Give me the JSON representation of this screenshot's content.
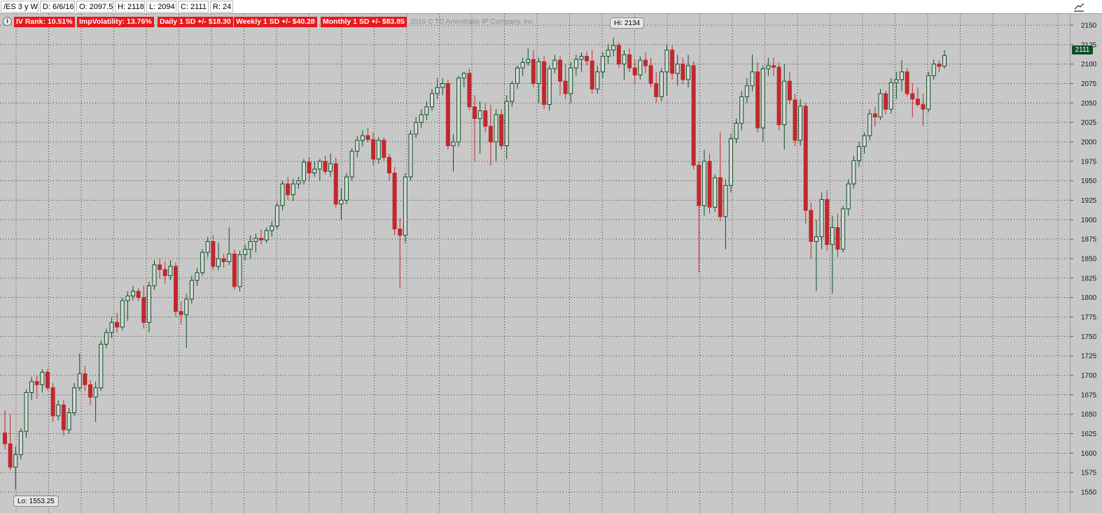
{
  "header": {
    "symbol_label": "/ES 3 y W",
    "date_label": "D: 6/6/16",
    "open_label": "O: 2097.5",
    "high_label": "H: 2118",
    "low_label": "L: 2094",
    "close_label": "C: 2111",
    "range_label": "R: 24"
  },
  "badges": {
    "iv_rank": "IV Rank: 10.51%",
    "imp_vol": "ImpVolatility: 13.76%",
    "daily_sd": "Daily 1 SD +/- $18.30",
    "weekly_sd": "Weekly 1 SD +/- $40.28",
    "monthly_sd": "Monthly 1 SD +/- $83.85"
  },
  "copyright": "2016 © TD Ameritrade IP Company, Inc.",
  "colors": {
    "up": "#0e4f26",
    "down": "#c0282d",
    "badge": "#e8181c",
    "background": "#c8c8c8"
  },
  "chart_data": {
    "type": "candlestick",
    "y_ticks": [
      1550,
      1575,
      1600,
      1625,
      1650,
      1675,
      1700,
      1725,
      1750,
      1775,
      1800,
      1825,
      1850,
      1875,
      1900,
      1925,
      1950,
      1975,
      2000,
      2025,
      2050,
      2075,
      2100,
      2125,
      2150
    ],
    "ylim": [
      1542,
      2158
    ],
    "grid": true,
    "hi_label": "Hi: 2134",
    "lo_label": "Lo: 1553.25",
    "last_price_label": "2111",
    "candles": [
      {
        "o": 1626,
        "h": 1655,
        "l": 1605,
        "c": 1612
      },
      {
        "o": 1612,
        "h": 1650,
        "l": 1578,
        "c": 1582
      },
      {
        "o": 1582,
        "h": 1608,
        "l": 1553.25,
        "c": 1598
      },
      {
        "o": 1598,
        "h": 1632,
        "l": 1592,
        "c": 1628
      },
      {
        "o": 1628,
        "h": 1682,
        "l": 1620,
        "c": 1678
      },
      {
        "o": 1678,
        "h": 1698,
        "l": 1668,
        "c": 1692
      },
      {
        "o": 1692,
        "h": 1700,
        "l": 1670,
        "c": 1688
      },
      {
        "o": 1688,
        "h": 1708,
        "l": 1678,
        "c": 1704
      },
      {
        "o": 1704,
        "h": 1708,
        "l": 1680,
        "c": 1684
      },
      {
        "o": 1684,
        "h": 1690,
        "l": 1640,
        "c": 1648
      },
      {
        "o": 1648,
        "h": 1668,
        "l": 1642,
        "c": 1662
      },
      {
        "o": 1662,
        "h": 1668,
        "l": 1622,
        "c": 1630
      },
      {
        "o": 1630,
        "h": 1658,
        "l": 1625,
        "c": 1652
      },
      {
        "o": 1652,
        "h": 1690,
        "l": 1648,
        "c": 1684
      },
      {
        "o": 1684,
        "h": 1728,
        "l": 1680,
        "c": 1702
      },
      {
        "o": 1702,
        "h": 1712,
        "l": 1680,
        "c": 1688
      },
      {
        "o": 1688,
        "h": 1694,
        "l": 1662,
        "c": 1672
      },
      {
        "o": 1672,
        "h": 1692,
        "l": 1640,
        "c": 1684
      },
      {
        "o": 1684,
        "h": 1745,
        "l": 1680,
        "c": 1740
      },
      {
        "o": 1740,
        "h": 1760,
        "l": 1735,
        "c": 1755
      },
      {
        "o": 1755,
        "h": 1775,
        "l": 1748,
        "c": 1768
      },
      {
        "o": 1768,
        "h": 1780,
        "l": 1755,
        "c": 1762
      },
      {
        "o": 1762,
        "h": 1800,
        "l": 1758,
        "c": 1796
      },
      {
        "o": 1796,
        "h": 1808,
        "l": 1770,
        "c": 1802
      },
      {
        "o": 1802,
        "h": 1815,
        "l": 1796,
        "c": 1808
      },
      {
        "o": 1808,
        "h": 1812,
        "l": 1795,
        "c": 1800
      },
      {
        "o": 1800,
        "h": 1815,
        "l": 1760,
        "c": 1768
      },
      {
        "o": 1768,
        "h": 1820,
        "l": 1755,
        "c": 1815
      },
      {
        "o": 1815,
        "h": 1848,
        "l": 1810,
        "c": 1842
      },
      {
        "o": 1842,
        "h": 1850,
        "l": 1825,
        "c": 1836
      },
      {
        "o": 1836,
        "h": 1846,
        "l": 1818,
        "c": 1828
      },
      {
        "o": 1828,
        "h": 1848,
        "l": 1822,
        "c": 1840
      },
      {
        "o": 1840,
        "h": 1845,
        "l": 1775,
        "c": 1782
      },
      {
        "o": 1782,
        "h": 1795,
        "l": 1765,
        "c": 1778
      },
      {
        "o": 1778,
        "h": 1805,
        "l": 1735,
        "c": 1798
      },
      {
        "o": 1798,
        "h": 1828,
        "l": 1792,
        "c": 1822
      },
      {
        "o": 1822,
        "h": 1838,
        "l": 1815,
        "c": 1832
      },
      {
        "o": 1832,
        "h": 1862,
        "l": 1828,
        "c": 1858
      },
      {
        "o": 1858,
        "h": 1878,
        "l": 1852,
        "c": 1872
      },
      {
        "o": 1872,
        "h": 1880,
        "l": 1835,
        "c": 1840
      },
      {
        "o": 1840,
        "h": 1870,
        "l": 1835,
        "c": 1850
      },
      {
        "o": 1850,
        "h": 1856,
        "l": 1838,
        "c": 1846
      },
      {
        "o": 1846,
        "h": 1890,
        "l": 1842,
        "c": 1856
      },
      {
        "o": 1856,
        "h": 1862,
        "l": 1810,
        "c": 1814
      },
      {
        "o": 1814,
        "h": 1860,
        "l": 1808,
        "c": 1855
      },
      {
        "o": 1855,
        "h": 1868,
        "l": 1848,
        "c": 1862
      },
      {
        "o": 1862,
        "h": 1880,
        "l": 1850,
        "c": 1872
      },
      {
        "o": 1872,
        "h": 1882,
        "l": 1858,
        "c": 1876
      },
      {
        "o": 1876,
        "h": 1888,
        "l": 1868,
        "c": 1874
      },
      {
        "o": 1874,
        "h": 1890,
        "l": 1870,
        "c": 1886
      },
      {
        "o": 1886,
        "h": 1898,
        "l": 1878,
        "c": 1892
      },
      {
        "o": 1892,
        "h": 1922,
        "l": 1888,
        "c": 1918
      },
      {
        "o": 1918,
        "h": 1950,
        "l": 1912,
        "c": 1946
      },
      {
        "o": 1946,
        "h": 1955,
        "l": 1926,
        "c": 1932
      },
      {
        "o": 1932,
        "h": 1952,
        "l": 1924,
        "c": 1946
      },
      {
        "o": 1946,
        "h": 1955,
        "l": 1940,
        "c": 1950
      },
      {
        "o": 1950,
        "h": 1978,
        "l": 1945,
        "c": 1974
      },
      {
        "o": 1974,
        "h": 1980,
        "l": 1950,
        "c": 1960
      },
      {
        "o": 1960,
        "h": 1975,
        "l": 1955,
        "c": 1965
      },
      {
        "o": 1965,
        "h": 1978,
        "l": 1950,
        "c": 1975
      },
      {
        "o": 1975,
        "h": 1982,
        "l": 1958,
        "c": 1962
      },
      {
        "o": 1962,
        "h": 1985,
        "l": 1955,
        "c": 1972
      },
      {
        "o": 1972,
        "h": 1980,
        "l": 1915,
        "c": 1920
      },
      {
        "o": 1920,
        "h": 1940,
        "l": 1900,
        "c": 1925
      },
      {
        "o": 1925,
        "h": 1960,
        "l": 1920,
        "c": 1955
      },
      {
        "o": 1955,
        "h": 1992,
        "l": 1950,
        "c": 1988
      },
      {
        "o": 1988,
        "h": 2008,
        "l": 1980,
        "c": 2002
      },
      {
        "o": 2002,
        "h": 2015,
        "l": 1994,
        "c": 2008
      },
      {
        "o": 2008,
        "h": 2018,
        "l": 2000,
        "c": 2003
      },
      {
        "o": 2003,
        "h": 2012,
        "l": 1970,
        "c": 1978
      },
      {
        "o": 1978,
        "h": 2006,
        "l": 1972,
        "c": 2002
      },
      {
        "o": 2002,
        "h": 2006,
        "l": 1975,
        "c": 1980
      },
      {
        "o": 1980,
        "h": 1985,
        "l": 1950,
        "c": 1960
      },
      {
        "o": 1960,
        "h": 1968,
        "l": 1880,
        "c": 1888
      },
      {
        "o": 1888,
        "h": 1902,
        "l": 1812,
        "c": 1880
      },
      {
        "o": 1880,
        "h": 1960,
        "l": 1870,
        "c": 1955
      },
      {
        "o": 1955,
        "h": 2015,
        "l": 1950,
        "c": 2010
      },
      {
        "o": 2010,
        "h": 2032,
        "l": 2005,
        "c": 2025
      },
      {
        "o": 2025,
        "h": 2042,
        "l": 2018,
        "c": 2035
      },
      {
        "o": 2035,
        "h": 2052,
        "l": 2028,
        "c": 2045
      },
      {
        "o": 2045,
        "h": 2068,
        "l": 2040,
        "c": 2062
      },
      {
        "o": 2062,
        "h": 2082,
        "l": 2055,
        "c": 2070
      },
      {
        "o": 2070,
        "h": 2082,
        "l": 2060,
        "c": 2075
      },
      {
        "o": 2075,
        "h": 2080,
        "l": 1990,
        "c": 1995
      },
      {
        "o": 1995,
        "h": 2010,
        "l": 1962,
        "c": 2000
      },
      {
        "o": 2000,
        "h": 2085,
        "l": 1994,
        "c": 2082
      },
      {
        "o": 2082,
        "h": 2090,
        "l": 2070,
        "c": 2088
      },
      {
        "o": 2088,
        "h": 2094,
        "l": 2040,
        "c": 2045
      },
      {
        "o": 2045,
        "h": 2060,
        "l": 1975,
        "c": 2030
      },
      {
        "o": 2030,
        "h": 2052,
        "l": 1985,
        "c": 2040
      },
      {
        "o": 2040,
        "h": 2050,
        "l": 2012,
        "c": 2020
      },
      {
        "o": 2020,
        "h": 2048,
        "l": 1970,
        "c": 2000
      },
      {
        "o": 2000,
        "h": 2042,
        "l": 1975,
        "c": 2035
      },
      {
        "o": 2035,
        "h": 2042,
        "l": 1990,
        "c": 1995
      },
      {
        "o": 1995,
        "h": 2060,
        "l": 1978,
        "c": 2052
      },
      {
        "o": 2052,
        "h": 2078,
        "l": 2045,
        "c": 2075
      },
      {
        "o": 2075,
        "h": 2098,
        "l": 2068,
        "c": 2095
      },
      {
        "o": 2095,
        "h": 2108,
        "l": 2085,
        "c": 2102
      },
      {
        "o": 2102,
        "h": 2120,
        "l": 2098,
        "c": 2106
      },
      {
        "o": 2106,
        "h": 2118,
        "l": 2070,
        "c": 2075
      },
      {
        "o": 2075,
        "h": 2108,
        "l": 2050,
        "c": 2103
      },
      {
        "o": 2103,
        "h": 2110,
        "l": 2042,
        "c": 2048
      },
      {
        "o": 2048,
        "h": 2098,
        "l": 2040,
        "c": 2094
      },
      {
        "o": 2094,
        "h": 2112,
        "l": 2088,
        "c": 2105
      },
      {
        "o": 2105,
        "h": 2110,
        "l": 2060,
        "c": 2078
      },
      {
        "o": 2078,
        "h": 2100,
        "l": 2055,
        "c": 2062
      },
      {
        "o": 2062,
        "h": 2102,
        "l": 2050,
        "c": 2095
      },
      {
        "o": 2095,
        "h": 2112,
        "l": 2085,
        "c": 2106
      },
      {
        "o": 2106,
        "h": 2115,
        "l": 2090,
        "c": 2110
      },
      {
        "o": 2110,
        "h": 2116,
        "l": 2098,
        "c": 2104
      },
      {
        "o": 2104,
        "h": 2118,
        "l": 2062,
        "c": 2068
      },
      {
        "o": 2068,
        "h": 2098,
        "l": 2062,
        "c": 2090
      },
      {
        "o": 2090,
        "h": 2115,
        "l": 2082,
        "c": 2110
      },
      {
        "o": 2110,
        "h": 2126,
        "l": 2100,
        "c": 2118
      },
      {
        "o": 2118,
        "h": 2134,
        "l": 2110,
        "c": 2124
      },
      {
        "o": 2124,
        "h": 2128,
        "l": 2095,
        "c": 2100
      },
      {
        "o": 2100,
        "h": 2118,
        "l": 2080,
        "c": 2112
      },
      {
        "o": 2112,
        "h": 2120,
        "l": 2090,
        "c": 2095
      },
      {
        "o": 2095,
        "h": 2106,
        "l": 2075,
        "c": 2086
      },
      {
        "o": 2086,
        "h": 2110,
        "l": 2080,
        "c": 2105
      },
      {
        "o": 2105,
        "h": 2115,
        "l": 2088,
        "c": 2098
      },
      {
        "o": 2098,
        "h": 2108,
        "l": 2070,
        "c": 2075
      },
      {
        "o": 2075,
        "h": 2090,
        "l": 2050,
        "c": 2058
      },
      {
        "o": 2058,
        "h": 2095,
        "l": 2052,
        "c": 2090
      },
      {
        "o": 2090,
        "h": 2126,
        "l": 2060,
        "c": 2118
      },
      {
        "o": 2118,
        "h": 2124,
        "l": 2080,
        "c": 2088
      },
      {
        "o": 2088,
        "h": 2112,
        "l": 2072,
        "c": 2100
      },
      {
        "o": 2100,
        "h": 2108,
        "l": 2074,
        "c": 2080
      },
      {
        "o": 2080,
        "h": 2112,
        "l": 2070,
        "c": 2098
      },
      {
        "o": 2098,
        "h": 2104,
        "l": 1965,
        "c": 1970
      },
      {
        "o": 1970,
        "h": 1975,
        "l": 1832,
        "c": 1918
      },
      {
        "o": 1918,
        "h": 1990,
        "l": 1905,
        "c": 1975
      },
      {
        "o": 1975,
        "h": 1985,
        "l": 1908,
        "c": 1916
      },
      {
        "o": 1916,
        "h": 1958,
        "l": 1910,
        "c": 1954
      },
      {
        "o": 1954,
        "h": 2012,
        "l": 1898,
        "c": 1904
      },
      {
        "o": 1904,
        "h": 1952,
        "l": 1862,
        "c": 1944
      },
      {
        "o": 1944,
        "h": 2010,
        "l": 1935,
        "c": 2004
      },
      {
        "o": 2004,
        "h": 2030,
        "l": 1998,
        "c": 2024
      },
      {
        "o": 2024,
        "h": 2065,
        "l": 2015,
        "c": 2058
      },
      {
        "o": 2058,
        "h": 2082,
        "l": 2050,
        "c": 2072
      },
      {
        "o": 2072,
        "h": 2112,
        "l": 2065,
        "c": 2090
      },
      {
        "o": 2090,
        "h": 2102,
        "l": 2012,
        "c": 2018
      },
      {
        "o": 2018,
        "h": 2098,
        "l": 2000,
        "c": 2094
      },
      {
        "o": 2094,
        "h": 2108,
        "l": 2085,
        "c": 2098
      },
      {
        "o": 2098,
        "h": 2108,
        "l": 2085,
        "c": 2096
      },
      {
        "o": 2096,
        "h": 2102,
        "l": 2015,
        "c": 2022
      },
      {
        "o": 2022,
        "h": 2100,
        "l": 1990,
        "c": 2078
      },
      {
        "o": 2078,
        "h": 2090,
        "l": 2048,
        "c": 2054
      },
      {
        "o": 2054,
        "h": 2062,
        "l": 1995,
        "c": 2002
      },
      {
        "o": 2002,
        "h": 2055,
        "l": 1995,
        "c": 2046
      },
      {
        "o": 2046,
        "h": 2050,
        "l": 1895,
        "c": 1912
      },
      {
        "o": 1912,
        "h": 1922,
        "l": 1850,
        "c": 1872
      },
      {
        "o": 1872,
        "h": 1900,
        "l": 1808,
        "c": 1878
      },
      {
        "o": 1878,
        "h": 1935,
        "l": 1862,
        "c": 1926
      },
      {
        "o": 1926,
        "h": 1938,
        "l": 1860,
        "c": 1868
      },
      {
        "o": 1868,
        "h": 1905,
        "l": 1805,
        "c": 1890
      },
      {
        "o": 1890,
        "h": 1908,
        "l": 1852,
        "c": 1862
      },
      {
        "o": 1862,
        "h": 1918,
        "l": 1858,
        "c": 1914
      },
      {
        "o": 1914,
        "h": 1952,
        "l": 1905,
        "c": 1946
      },
      {
        "o": 1946,
        "h": 1982,
        "l": 1940,
        "c": 1976
      },
      {
        "o": 1976,
        "h": 2000,
        "l": 1968,
        "c": 1994
      },
      {
        "o": 1994,
        "h": 2012,
        "l": 1985,
        "c": 2008
      },
      {
        "o": 2008,
        "h": 2042,
        "l": 2002,
        "c": 2036
      },
      {
        "o": 2036,
        "h": 2045,
        "l": 2020,
        "c": 2032
      },
      {
        "o": 2032,
        "h": 2068,
        "l": 2028,
        "c": 2062
      },
      {
        "o": 2062,
        "h": 2066,
        "l": 2035,
        "c": 2042
      },
      {
        "o": 2042,
        "h": 2082,
        "l": 2036,
        "c": 2076
      },
      {
        "o": 2076,
        "h": 2090,
        "l": 2055,
        "c": 2080
      },
      {
        "o": 2080,
        "h": 2105,
        "l": 2065,
        "c": 2090
      },
      {
        "o": 2090,
        "h": 2095,
        "l": 2058,
        "c": 2062
      },
      {
        "o": 2062,
        "h": 2075,
        "l": 2032,
        "c": 2055
      },
      {
        "o": 2055,
        "h": 2070,
        "l": 2045,
        "c": 2048
      },
      {
        "o": 2048,
        "h": 2062,
        "l": 2020,
        "c": 2042
      },
      {
        "o": 2042,
        "h": 2090,
        "l": 2038,
        "c": 2085
      },
      {
        "o": 2085,
        "h": 2106,
        "l": 2080,
        "c": 2100
      },
      {
        "o": 2100,
        "h": 2105,
        "l": 2090,
        "c": 2097
      },
      {
        "o": 2097.5,
        "h": 2118,
        "l": 2094,
        "c": 2111
      }
    ]
  }
}
